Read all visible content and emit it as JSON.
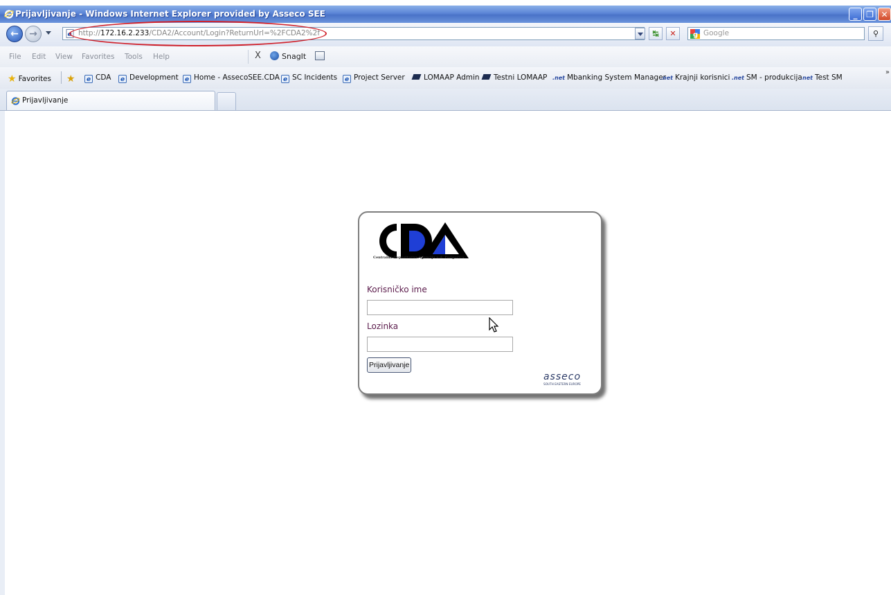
{
  "window": {
    "title": "Prijavljivanje - Windows Internet Explorer provided by Asseco SEE",
    "controls": [
      "minimize",
      "restore",
      "close"
    ]
  },
  "address_bar": {
    "url_prefix": "http://",
    "url_host": "172.16.2.233",
    "url_path": "/CDA2/Account/Login?ReturnUrl=%2FCDA2%2f",
    "search_placeholder": "Google",
    "highlight_color": "#d0202a"
  },
  "menu": {
    "items": [
      "File",
      "Edit",
      "View",
      "Favorites",
      "Tools",
      "Help"
    ],
    "close_glyph": "X",
    "snagit_label": "SnagIt"
  },
  "favorites": {
    "label": "Favorites",
    "items": [
      {
        "label": "CDA",
        "icon": "ie-icon"
      },
      {
        "label": "Development",
        "icon": "ie-icon"
      },
      {
        "label": "Home - AssecoSEE.CDA",
        "icon": "ie-icon"
      },
      {
        "label": "SC Incidents",
        "icon": "ie-icon"
      },
      {
        "label": "Project Server",
        "icon": "ie-icon"
      },
      {
        "label": "LOMAAP Admin",
        "icon": "diamond-icon"
      },
      {
        "label": "Testni LOMAAP",
        "icon": "diamond-icon"
      },
      {
        "label": "Mbanking System Manager",
        "icon": "net-icon"
      },
      {
        "label": "Krajnji korisnici",
        "icon": "net-icon"
      },
      {
        "label": "SM - produkcija",
        "icon": "net-icon"
      },
      {
        "label": "Test SM",
        "icon": "net-icon"
      }
    ],
    "net_glyph": ".net"
  },
  "tabs": [
    {
      "label": "Prijavljivanje",
      "active": true
    }
  ],
  "login": {
    "logo_text": "CDA",
    "logo_subtitle": "Centralna Depozitarna Agencija a.d. Podgorica",
    "username_label": "Korisničko ime",
    "username_value": "",
    "password_label": "Lozinka",
    "password_value": "",
    "submit_label": "Prijavljivanje",
    "footer_brand": "asseco",
    "footer_tagline": "SOUTH EASTERN EUROPE",
    "label_color": "#5a1a4a",
    "logo_accent": "#1f3fd6"
  }
}
